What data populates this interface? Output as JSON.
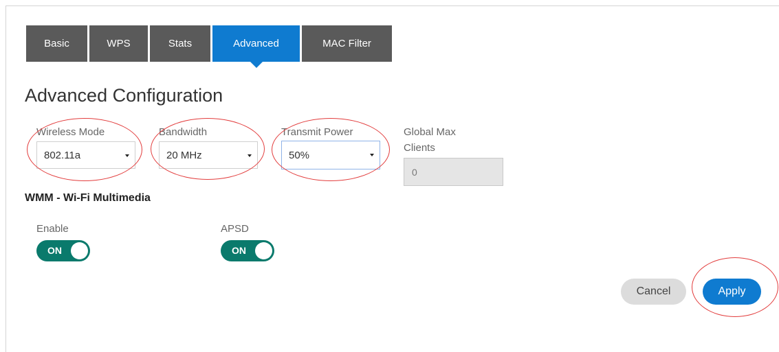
{
  "tabs": [
    {
      "label": "Basic"
    },
    {
      "label": "WPS"
    },
    {
      "label": "Stats"
    },
    {
      "label": "Advanced",
      "active": true
    },
    {
      "label": "MAC Filter"
    }
  ],
  "page_title": "Advanced Configuration",
  "fields": {
    "wireless_mode": {
      "label": "Wireless Mode",
      "value": "802.11a"
    },
    "bandwidth": {
      "label": "Bandwidth",
      "value": "20 MHz"
    },
    "transmit_power": {
      "label": "Transmit Power",
      "value": "50%"
    },
    "global_max_clients": {
      "label_line1": "Global Max",
      "label_line2": "Clients",
      "value": "0"
    }
  },
  "wmm": {
    "title": "WMM - Wi-Fi Multimedia",
    "enable": {
      "label": "Enable",
      "state": "ON"
    },
    "apsd": {
      "label": "APSD",
      "state": "ON"
    }
  },
  "buttons": {
    "cancel": "Cancel",
    "apply": "Apply"
  },
  "colors": {
    "tab_default": "#5a5a5a",
    "tab_active": "#0f7bd0",
    "toggle_on": "#0a7a6c",
    "apply_button": "#0f7bd0",
    "annotation": "#e23b3b"
  }
}
